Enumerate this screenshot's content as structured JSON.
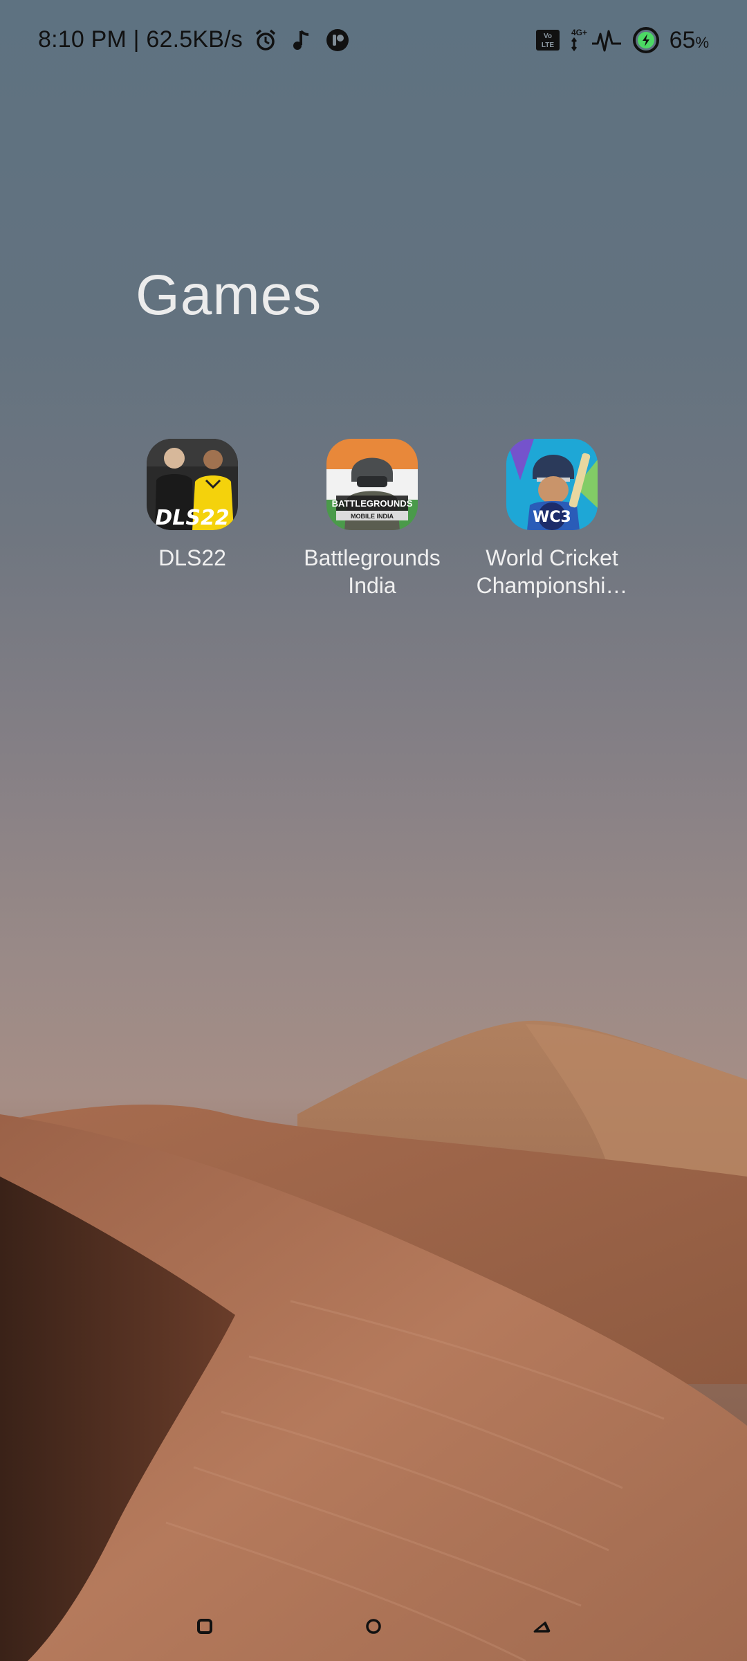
{
  "status_bar": {
    "time_speed": "8:10 PM | 62.5KB/s",
    "left_icons": [
      "alarm-icon",
      "music-note-icon",
      "app-notification-icon"
    ],
    "right_icons": [
      "volte-icon",
      "network-4g-icon",
      "signal-icon",
      "charging-icon"
    ],
    "volte_label": "Vo\nLTE",
    "network_label": "4G+",
    "battery_value": "65",
    "battery_unit": "%"
  },
  "folder": {
    "title": "Games",
    "apps": [
      {
        "label": "DLS22",
        "icon": "dls22-app-icon",
        "icon_text": "DLS22"
      },
      {
        "label": "Battlegrounds\nIndia",
        "icon": "battlegrounds-india-app-icon",
        "icon_text": "BATTLEGROUNDS",
        "icon_subtext": "MOBILE INDIA"
      },
      {
        "label": "World Cricket\nChampionshi…",
        "icon": "world-cricket-championship-app-icon",
        "icon_text": "WC3"
      }
    ]
  },
  "navigation": {
    "buttons": [
      "recents-icon",
      "home-icon",
      "back-icon"
    ]
  },
  "colors": {
    "status_text": "#111111",
    "label_text": "#f0f0f0",
    "charging": "#4cd964"
  }
}
